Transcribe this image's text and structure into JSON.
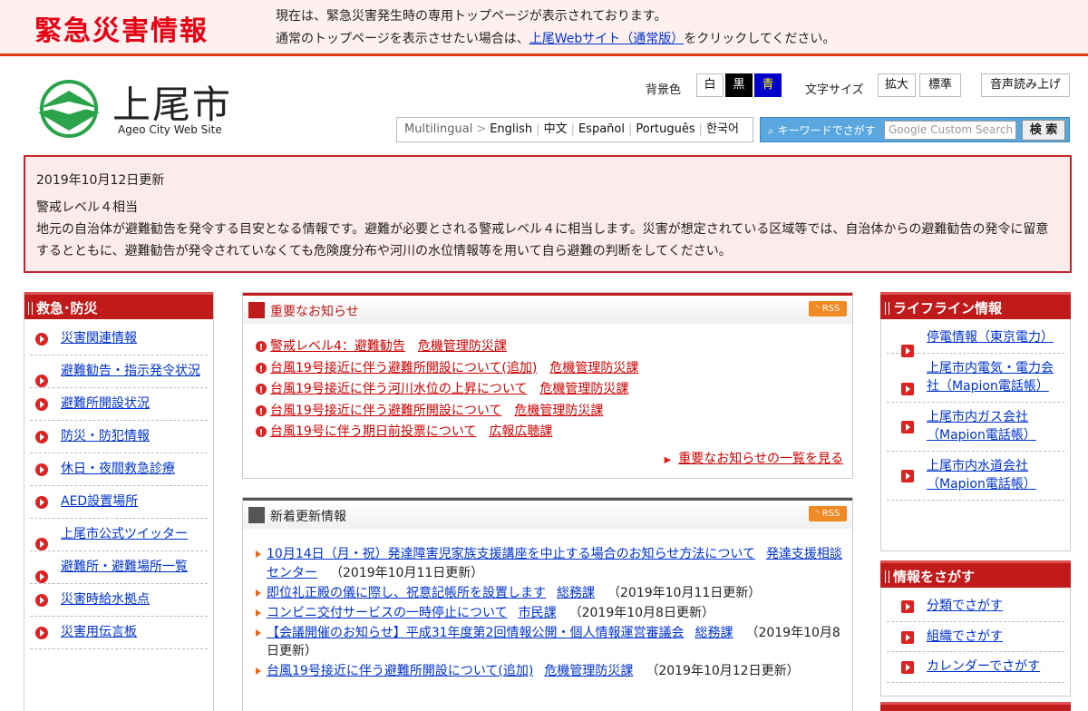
{
  "emergency": {
    "title": "緊急災害情報",
    "line1": "現在は、緊急災害発生時の専用トップページが表示されております。",
    "line2_before": "通常のトップページを表示させたい場合は、",
    "line2_link": "上尾Webサイト（通常版）",
    "line2_after": "をクリックしてください。"
  },
  "header": {
    "logo_name": "上尾市",
    "logo_sub": "Ageo City Web Site",
    "bg_label": "背景色",
    "bg_white": "白",
    "bg_black": "黒",
    "bg_blue": "青",
    "fontsize_label": "文字サイズ",
    "fontsize_large": "拡大",
    "fontsize_standard": "標準",
    "voice": "音声読み上げ",
    "multilingual_label": "Multilingual",
    "languages": [
      "English",
      "中文",
      "Español",
      "Português",
      "한국어"
    ],
    "search_label": "キーワードでさがす",
    "search_placeholder": "Google Custom Search",
    "search_button": "検 索"
  },
  "alert": {
    "date": "2019年10月12日更新",
    "level": "警戒レベル４相当",
    "body": "地元の自治体が避難勧告を発令する目安となる情報です。避難が必要とされる警戒レベル４に相当します。災害が想定されている区域等では、自治体からの避難勧告の発令に留意するとともに、避難勧告が発令されていなくても危険度分布や河川の水位情報等を用いて自ら避難の判断をしてください。"
  },
  "left": {
    "title": "救急･防災",
    "items": [
      "災害関連情報",
      "避難勧告・指示発令状況",
      "避難所開設状況",
      "防災・防犯情報",
      "休日・夜間救急診療",
      "AED設置場所",
      "上尾市公式ツイッター",
      "避難所・避難場所一覧",
      "災害時給水拠点",
      "災害用伝言板"
    ]
  },
  "important": {
    "title": "重要なお知らせ",
    "rss": "RSS",
    "items": [
      {
        "text": "警戒レベル4：避難勧告",
        "dept": "危機管理防災課"
      },
      {
        "text": "台風19号接近に伴う避難所開設について(追加)",
        "dept": "危機管理防災課"
      },
      {
        "text": "台風19号接近に伴う河川水位の上昇について",
        "dept": "危機管理防災課"
      },
      {
        "text": "台風19号接近に伴う避難所開設について",
        "dept": "危機管理防災課"
      },
      {
        "text": "台風19号に伴う期日前投票について",
        "dept": "広報広聴課"
      }
    ],
    "more": "重要なお知らせの一覧を見る"
  },
  "news": {
    "title": "新着更新情報",
    "rss": "RSS",
    "items": [
      {
        "text": "10月14日（月・祝）発達障害児家族支援講座を中止する場合のお知らせ方法について",
        "dept": "発達支援相談センター",
        "date": "（2019年10月11日更新）"
      },
      {
        "text": "即位礼正殿の儀に際し、祝意記帳所を設置します",
        "dept": "総務課",
        "date": "（2019年10月11日更新）"
      },
      {
        "text": "コンビニ交付サービスの一時停止について",
        "dept": "市民課",
        "date": "（2019年10月8日更新）"
      },
      {
        "text": "【会議開催のお知らせ】平成31年度第2回情報公開・個人情報運営審議会",
        "dept": "総務課",
        "date": "（2019年10月8日更新）"
      },
      {
        "text": "台風19号接近に伴う避難所開設について(追加)",
        "dept": "危機管理防災課",
        "date": "（2019年10月12日更新）"
      }
    ]
  },
  "lifeline": {
    "title": "ライフライン情報",
    "items": [
      "停電情報（東京電力）",
      "上尾市内電気・電力会社（Mapion電話帳）",
      "上尾市内ガス会社（Mapion電話帳）",
      "上尾市内水道会社（Mapion電話帳）"
    ]
  },
  "find": {
    "title": "情報をさがす",
    "items": [
      "分類でさがす",
      "組織でさがす",
      "カレンダーでさがす"
    ]
  },
  "colors": {
    "accent": "#c01a1a",
    "emergency_red": "#e60012",
    "alert_bg": "#fdeaea",
    "link": "#0033cc"
  }
}
